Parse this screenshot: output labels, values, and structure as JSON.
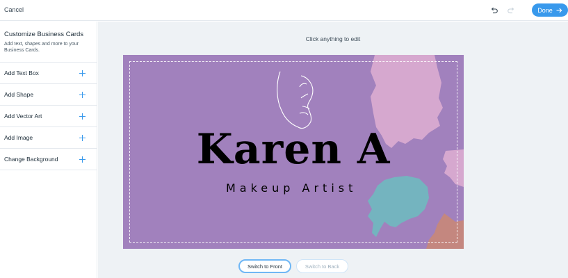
{
  "topbar": {
    "cancel_label": "Cancel",
    "done_label": "Done",
    "undo_icon": "undo-icon",
    "redo_icon": "redo-icon"
  },
  "sidebar": {
    "title": "Customize Business Cards",
    "subtitle": "Add text, shapes and more to your Business Cards.",
    "items": [
      {
        "label": "Add Text Box"
      },
      {
        "label": "Add Shape"
      },
      {
        "label": "Add Vector Art"
      },
      {
        "label": "Add Image"
      },
      {
        "label": "Change Background"
      }
    ]
  },
  "canvas": {
    "hint": "Click anything to edit",
    "card": {
      "name": "Karen A",
      "role": "Makeup Artist",
      "background_color": "#a181bd"
    },
    "switch_front_label": "Switch to Front",
    "switch_back_label": "Switch to Back"
  },
  "colors": {
    "accent": "#3899ec",
    "card_purple": "#a181bd",
    "brush_pink": "#d6a8cf",
    "brush_teal": "#74b4bf",
    "brush_tan": "#c4877f"
  }
}
